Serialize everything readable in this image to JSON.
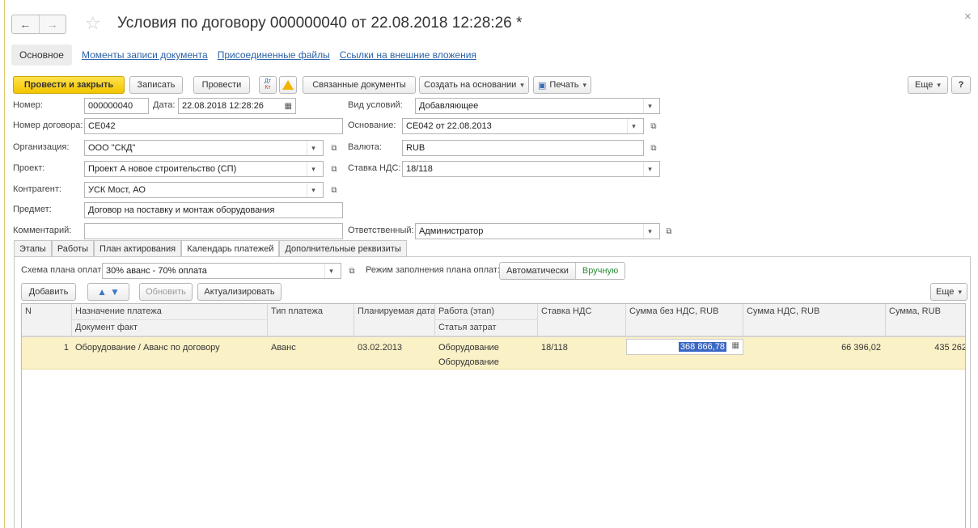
{
  "window": {
    "title": "Условия по договору 000000040 от 22.08.2018 12:28:26 *",
    "back": "←",
    "forward": "→",
    "star": "☆",
    "close": "×"
  },
  "sections": {
    "active": "Основное",
    "links": [
      "Моменты записи документа",
      "Присоединенные файлы",
      "Ссылки на внешние вложения"
    ]
  },
  "toolbar": {
    "post_close": "Провести и закрыть",
    "save": "Записать",
    "post": "Провести",
    "dtkt_top": "Дт",
    "dtkt_bottom": "Кт",
    "warning": "!",
    "related": "Связанные документы",
    "create_based": "Создать на основании",
    "print": "Печать",
    "more": "Еще",
    "help": "?"
  },
  "form": {
    "number_label": "Номер:",
    "number": "000000040",
    "date_label": "Дата:",
    "date": "22.08.2018 12:28:26",
    "contract_no_label": "Номер договора:",
    "contract_no": "СЕ042",
    "org_label": "Организация:",
    "org": "ООО \"СКД\"",
    "project_label": "Проект:",
    "project": "Проект А новое строительство (СП)",
    "counterparty_label": "Контрагент:",
    "counterparty": "УСК Мост, АО",
    "subject_label": "Предмет:",
    "subject": "Договор на поставку и монтаж оборудования",
    "comment_label": "Комментарий:",
    "comment": "",
    "cond_type_label": "Вид условий:",
    "cond_type": "Добавляющее",
    "basis_label": "Основание:",
    "basis": "СЕ042 от 22.08.2013",
    "currency_label": "Валюта:",
    "currency": "RUB",
    "vat_label": "Ставка НДС:",
    "vat": "18/118",
    "responsible_label": "Ответственный:",
    "responsible": "Администратор"
  },
  "tabs": [
    "Этапы",
    "Работы",
    "План актирования",
    "Календарь платежей",
    "Дополнительные реквизиты"
  ],
  "payments": {
    "scheme_label": "Схема плана оплат:",
    "scheme": "30% аванс - 70% оплата",
    "mode_label": "Режим заполнения плана оплат:",
    "mode_auto": "Автоматически",
    "mode_manual": "Вручную",
    "add": "Добавить",
    "refresh": "Обновить",
    "actualize": "Актуализировать",
    "more": "Еще"
  },
  "table": {
    "headers": {
      "n": "N",
      "purpose": "Назначение платежа",
      "doc_fact": "Документ факт",
      "pay_type": "Тип платежа",
      "plan_date": "Планируемая дата",
      "work": "Работа (этап)",
      "cost_item": "Статья затрат",
      "vat_rate": "Ставка НДС",
      "sum_no_vat": "Сумма без НДС, RUB",
      "vat_sum": "Сумма НДС, RUB",
      "sum": "Сумма, RUB"
    },
    "rows": [
      {
        "n": "1",
        "purpose": "Оборудование / Аванс по договору",
        "pay_type": "Аванс",
        "plan_date": "03.02.2013",
        "work": "Оборудование",
        "cost_item": "Оборудование",
        "vat_rate": "18/118",
        "sum_no_vat": "368 866,78",
        "vat_sum": "66 396,02",
        "sum": "435 262"
      }
    ]
  }
}
